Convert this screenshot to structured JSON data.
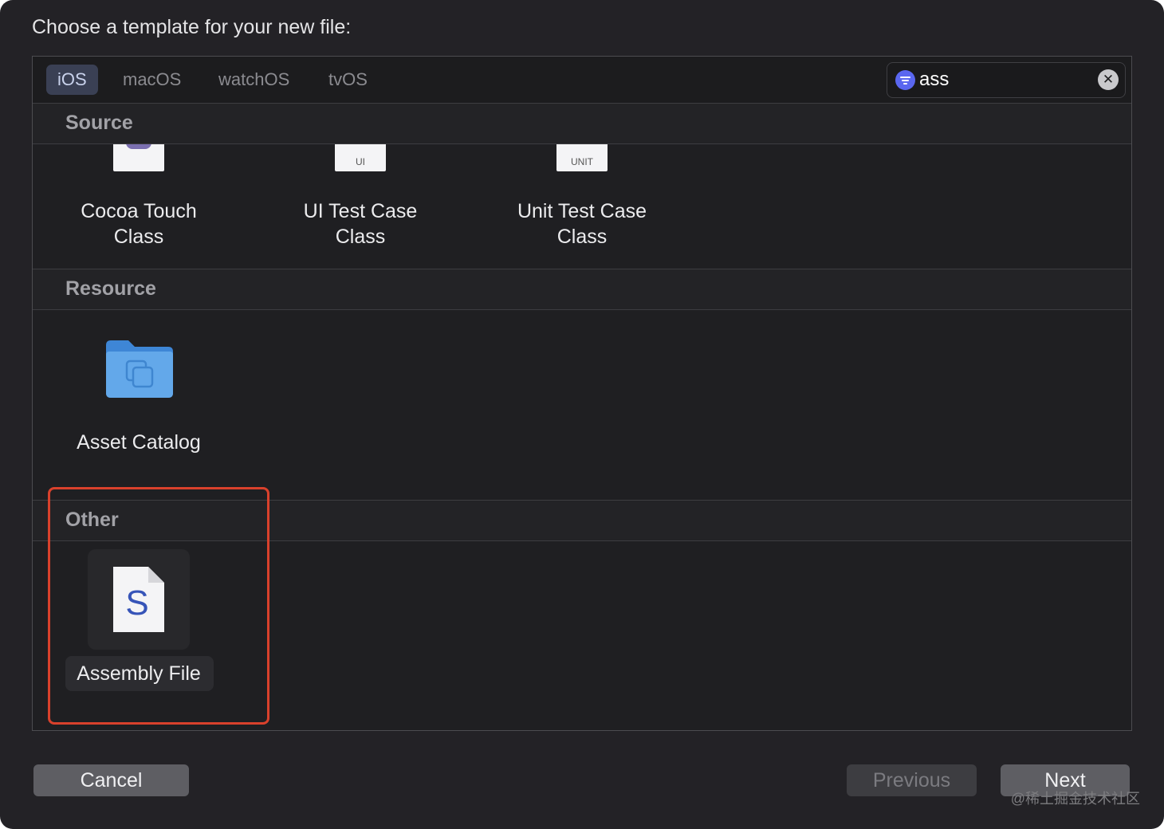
{
  "dialog": {
    "prompt": "Choose a template for your new file:"
  },
  "platform_tabs": [
    {
      "label": "iOS",
      "selected": true
    },
    {
      "label": "macOS",
      "selected": false
    },
    {
      "label": "watchOS",
      "selected": false
    },
    {
      "label": "tvOS",
      "selected": false
    }
  ],
  "search": {
    "value": "ass",
    "filter_icon": "filter-icon",
    "clear_icon": "clear-icon"
  },
  "sections": [
    {
      "title": "Source",
      "templates": [
        {
          "label_lines": [
            "Cocoa Touch",
            "Class"
          ],
          "icon": "cocoa-touch-class-icon"
        },
        {
          "label_lines": [
            "UI Test Case",
            "Class"
          ],
          "icon": "ui-test-case-icon",
          "tag": "UI"
        },
        {
          "label_lines": [
            "Unit Test Case",
            "Class"
          ],
          "icon": "unit-test-case-icon",
          "tag": "UNIT"
        }
      ]
    },
    {
      "title": "Resource",
      "templates": [
        {
          "label_lines": [
            "Asset Catalog"
          ],
          "icon": "folder-icon"
        }
      ]
    },
    {
      "title": "Other",
      "templates": [
        {
          "label_lines": [
            "Assembly File"
          ],
          "icon": "assembly-file-icon",
          "glyph": "S",
          "selected": true
        }
      ]
    }
  ],
  "buttons": {
    "cancel": "Cancel",
    "previous": "Previous",
    "next": "Next"
  },
  "watermark": "@稀土掘金技术社区",
  "colors": {
    "accent": "#5a67f0",
    "highlight_outline": "#d9412c",
    "folder": "#63a8ea"
  }
}
